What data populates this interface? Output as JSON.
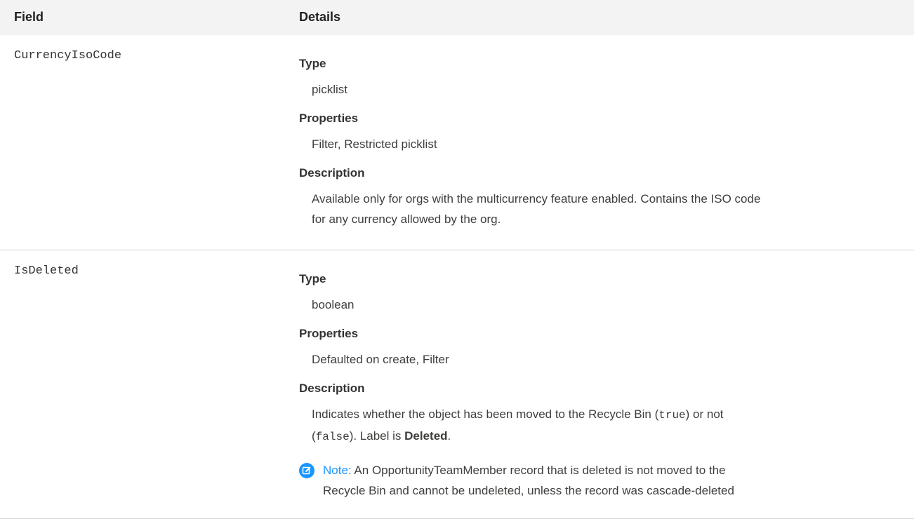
{
  "header": {
    "field": "Field",
    "details": "Details"
  },
  "rows": [
    {
      "name": "CurrencyIsoCode",
      "type_label": "Type",
      "type_value": "picklist",
      "properties_label": "Properties",
      "properties_value": "Filter, Restricted picklist",
      "description_label": "Description",
      "description_line1": "Available only for orgs with the multicurrency feature enabled. Contains the ISO code",
      "description_line2": "for any currency allowed by the org."
    },
    {
      "name": "IsDeleted",
      "type_label": "Type",
      "type_value": "boolean",
      "properties_label": "Properties",
      "properties_value": "Defaulted on create, Filter",
      "description_label": "Description",
      "description_part1": "Indicates whether the object has been moved to the Recycle Bin (",
      "description_code_true": "true",
      "description_part2": ") or not",
      "description_part3": "(",
      "description_code_false": "false",
      "description_part4": "). Label is ",
      "description_bold": "Deleted",
      "description_part5": ".",
      "note_label": "Note:",
      "note_line1": " An OpportunityTeamMember record that is deleted is not moved to the",
      "note_line2": "Recycle Bin and cannot be undeleted, unless the record was cascade-deleted"
    }
  ],
  "icons": {
    "note": "note-edit-icon"
  },
  "colors": {
    "accent": "#1b96ff",
    "header_bg": "#f3f3f3"
  }
}
